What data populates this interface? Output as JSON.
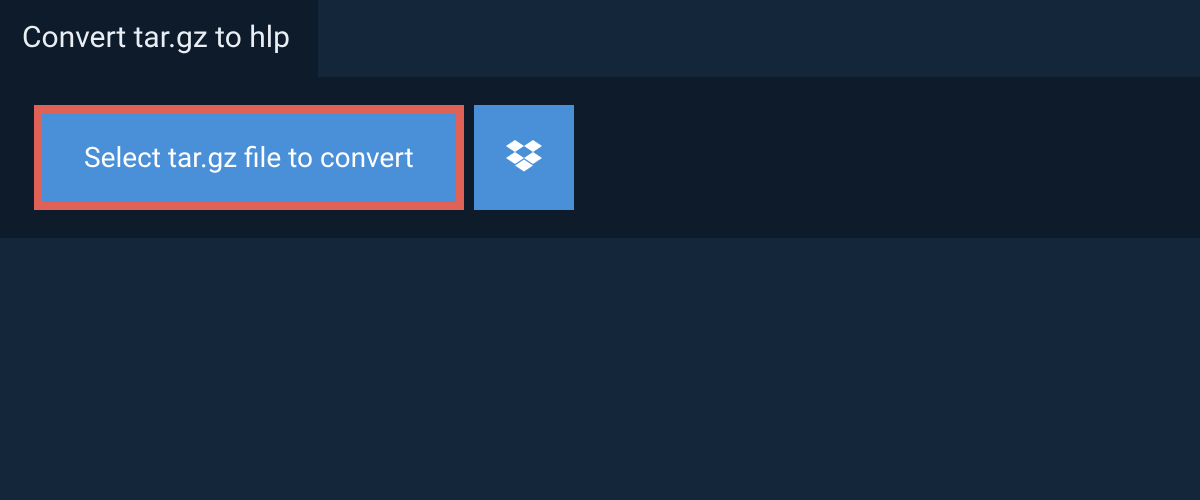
{
  "header": {
    "title": "Convert tar.gz to hlp"
  },
  "actions": {
    "select_file_label": "Select tar.gz file to convert",
    "dropbox_icon": "dropbox-icon"
  },
  "colors": {
    "background_outer": "#14273a",
    "background_panel": "#0d1b2a",
    "button_fill": "#4a90d9",
    "button_border": "#e06256",
    "text_light": "#e8eef4"
  }
}
